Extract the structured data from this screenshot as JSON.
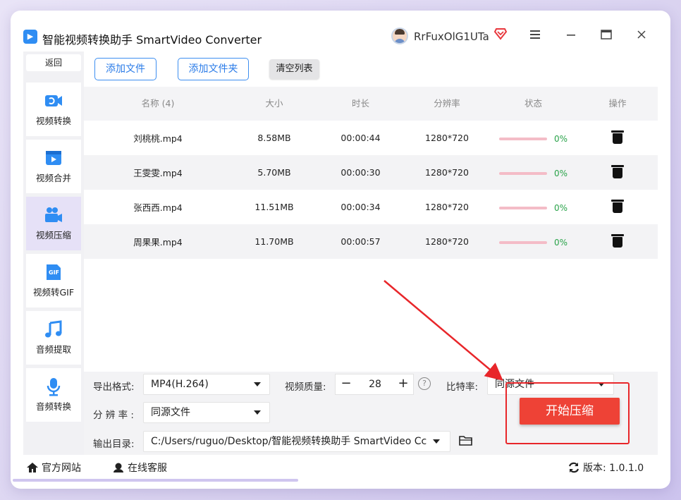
{
  "app": {
    "title": "智能视频转换助手 SmartVideo Converter",
    "logo_glyph": "▶"
  },
  "user": {
    "name": "RrFuxOlG1UTa"
  },
  "colors": {
    "accent": "#2b7ce8",
    "active_nav": "#e6e1f7",
    "start_button": "#ee4236",
    "progress_pct": "#2aa34a",
    "highlight": "#e8262a"
  },
  "sidebar": {
    "back_label": "返回",
    "items": [
      {
        "label": "视频转换",
        "icon": "video-convert-icon"
      },
      {
        "label": "视频合并",
        "icon": "video-merge-icon"
      },
      {
        "label": "视频压缩",
        "icon": "video-compress-icon",
        "active": true
      },
      {
        "label": "视频转GIF",
        "icon": "gif-icon"
      },
      {
        "label": "音频提取",
        "icon": "music-note-icon"
      },
      {
        "label": "音频转换",
        "icon": "microphone-icon"
      }
    ]
  },
  "toolbar": {
    "add_file": "添加文件",
    "add_folder": "添加文件夹",
    "clear_list": "清空列表"
  },
  "table": {
    "headers": [
      "名称 (4)",
      "大小",
      "时长",
      "分辨率",
      "状态",
      "操作"
    ],
    "rows": [
      {
        "name": "刘桃桃.mp4",
        "size": "8.58MB",
        "duration": "00:00:44",
        "resolution": "1280*720",
        "progress": "0%"
      },
      {
        "name": "王雯雯.mp4",
        "size": "5.70MB",
        "duration": "00:00:30",
        "resolution": "1280*720",
        "progress": "0%"
      },
      {
        "name": "张西西.mp4",
        "size": "11.51MB",
        "duration": "00:00:34",
        "resolution": "1280*720",
        "progress": "0%"
      },
      {
        "name": "周果果.mp4",
        "size": "11.70MB",
        "duration": "00:00:57",
        "resolution": "1280*720",
        "progress": "0%"
      }
    ]
  },
  "settings": {
    "format_label": "导出格式:",
    "format_value": "MP4(H.264)",
    "quality_label": "视频质量:",
    "quality_value": "28",
    "quality_minus": "−",
    "quality_plus": "+",
    "help": "?",
    "bitrate_label": "比特率:",
    "bitrate_value": "同源文件",
    "resolution_label": "分 辨 率 :",
    "resolution_value": "同源文件",
    "output_label": "输出目录:",
    "output_value": "C:/Users/ruguo/Desktop/智能视频转换助手 SmartVideo Cc",
    "start_button": "开始压缩"
  },
  "footer": {
    "website": "官方网站",
    "support": "在线客服",
    "version": "版本:  1.0.1.0"
  }
}
